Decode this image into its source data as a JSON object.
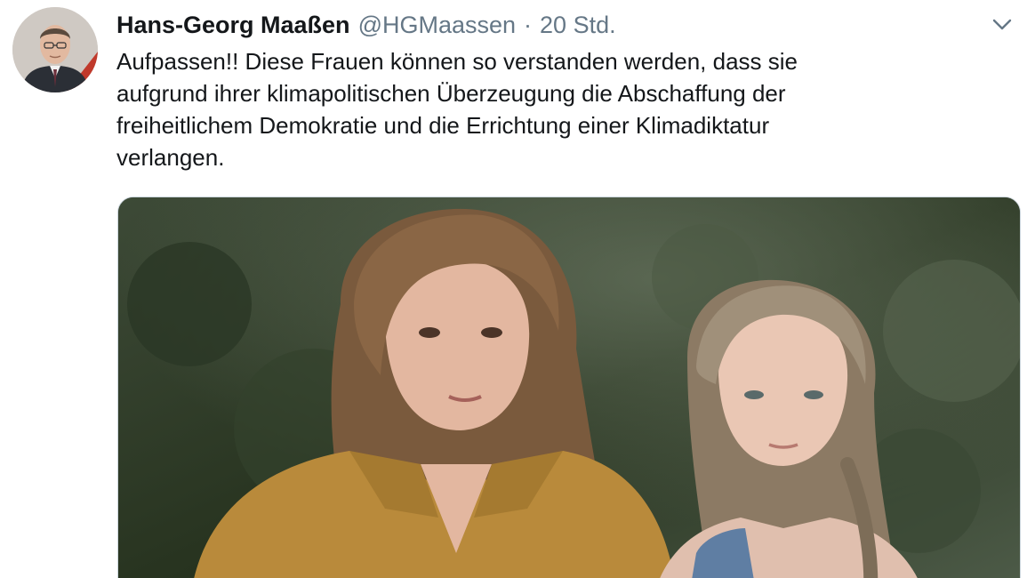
{
  "tweet": {
    "author": {
      "display_name": "Hans-Georg Maaßen",
      "handle": "@HGMaassen",
      "avatar_icon": "profile-photo"
    },
    "separator": "·",
    "timestamp": "20 Std.",
    "text_lines": [
      "Aufpassen!! Diese Frauen können so verstanden werden, dass sie",
      "aufgrund ihrer klimapolitischen Überzeugung die Abschaffung der",
      "freiheitlichem Demokratie und die Errichtung einer Klimadiktatur",
      "verlangen."
    ],
    "menu_icon": "chevron-down-icon",
    "media": {
      "type": "photo",
      "description_icon": "photo-two-young-women-forest"
    }
  },
  "colors": {
    "text_primary": "#14171a",
    "text_secondary": "#657786",
    "border": "#ccd6dd"
  }
}
